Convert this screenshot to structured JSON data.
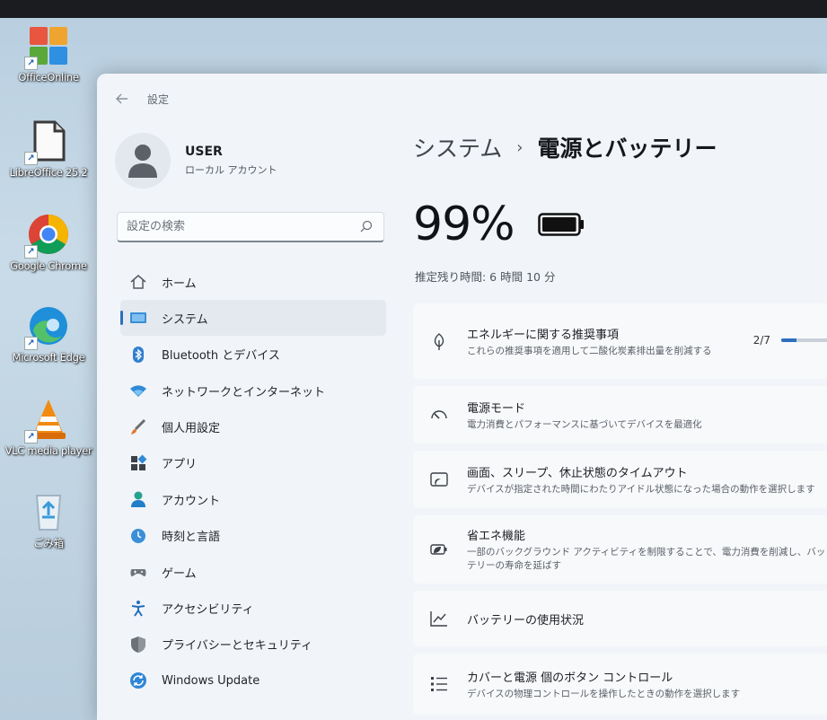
{
  "desktop": {
    "icons": [
      {
        "label": "OfficeOnline",
        "icon": "office-online-icon"
      },
      {
        "label": "LibreOffice 25.2",
        "icon": "libreoffice-icon"
      },
      {
        "label": "Google Chrome",
        "icon": "chrome-icon"
      },
      {
        "label": "Microsoft Edge",
        "icon": "edge-icon"
      },
      {
        "label": "VLC media player",
        "icon": "vlc-icon"
      },
      {
        "label": "ごみ箱",
        "icon": "recycle-bin-icon"
      }
    ]
  },
  "window": {
    "title": "設定"
  },
  "profile": {
    "name": "USER",
    "account_type": "ローカル アカウント"
  },
  "search": {
    "placeholder": "設定の検索"
  },
  "sidebar": {
    "items": [
      {
        "label": "ホーム",
        "icon": "home-icon"
      },
      {
        "label": "システム",
        "icon": "system-icon",
        "active": true
      },
      {
        "label": "Bluetooth とデバイス",
        "icon": "bluetooth-icon"
      },
      {
        "label": "ネットワークとインターネット",
        "icon": "network-icon"
      },
      {
        "label": "個人用設定",
        "icon": "personalization-icon"
      },
      {
        "label": "アプリ",
        "icon": "apps-icon"
      },
      {
        "label": "アカウント",
        "icon": "account-icon"
      },
      {
        "label": "時刻と言語",
        "icon": "time-language-icon"
      },
      {
        "label": "ゲーム",
        "icon": "gaming-icon"
      },
      {
        "label": "アクセシビリティ",
        "icon": "accessibility-icon"
      },
      {
        "label": "プライバシーとセキュリティ",
        "icon": "privacy-icon"
      },
      {
        "label": "Windows Update",
        "icon": "windows-update-icon"
      }
    ]
  },
  "main": {
    "breadcrumb_parent": "システム",
    "breadcrumb_separator": "›",
    "page_title": "電源とバッテリー",
    "battery_percent": "99%",
    "battery_level": 0.99,
    "remaining_label": "推定残り時間: 6 時間 10 分",
    "cards": [
      {
        "title": "エネルギーに関する推奨事項",
        "description": "これらの推奨事項を適用して二酸化炭素排出量を削減する",
        "progress_text": "2/7",
        "progress_fraction": 0.2857,
        "icon": "leaf-icon"
      },
      {
        "title": "電源モード",
        "description": "電力消費とパフォーマンスに基づいてデバイスを最適化",
        "icon": "power-mode-icon"
      },
      {
        "title": "画面、スリープ、休止状態のタイムアウト",
        "description": "デバイスが指定された時間にわたりアイドル状態になった場合の動作を選択します",
        "icon": "screen-sleep-icon"
      },
      {
        "title": "省エネ機能",
        "description": "一部のバックグラウンド アクティビティを制限することで、電力消費を削減し、バッテリーの寿命を延ばす",
        "icon": "energy-saver-icon"
      },
      {
        "title": "バッテリーの使用状況",
        "description": "",
        "icon": "battery-usage-icon"
      },
      {
        "title": "カバーと電源 個のボタン コントロール",
        "description": "デバイスの物理コントロールを操作したときの動作を選択します",
        "icon": "button-controls-icon"
      }
    ]
  },
  "colors": {
    "accent": "#2d6fbf",
    "window_bg": "#f1f4f8",
    "card_bg": "#f8f9fb"
  }
}
